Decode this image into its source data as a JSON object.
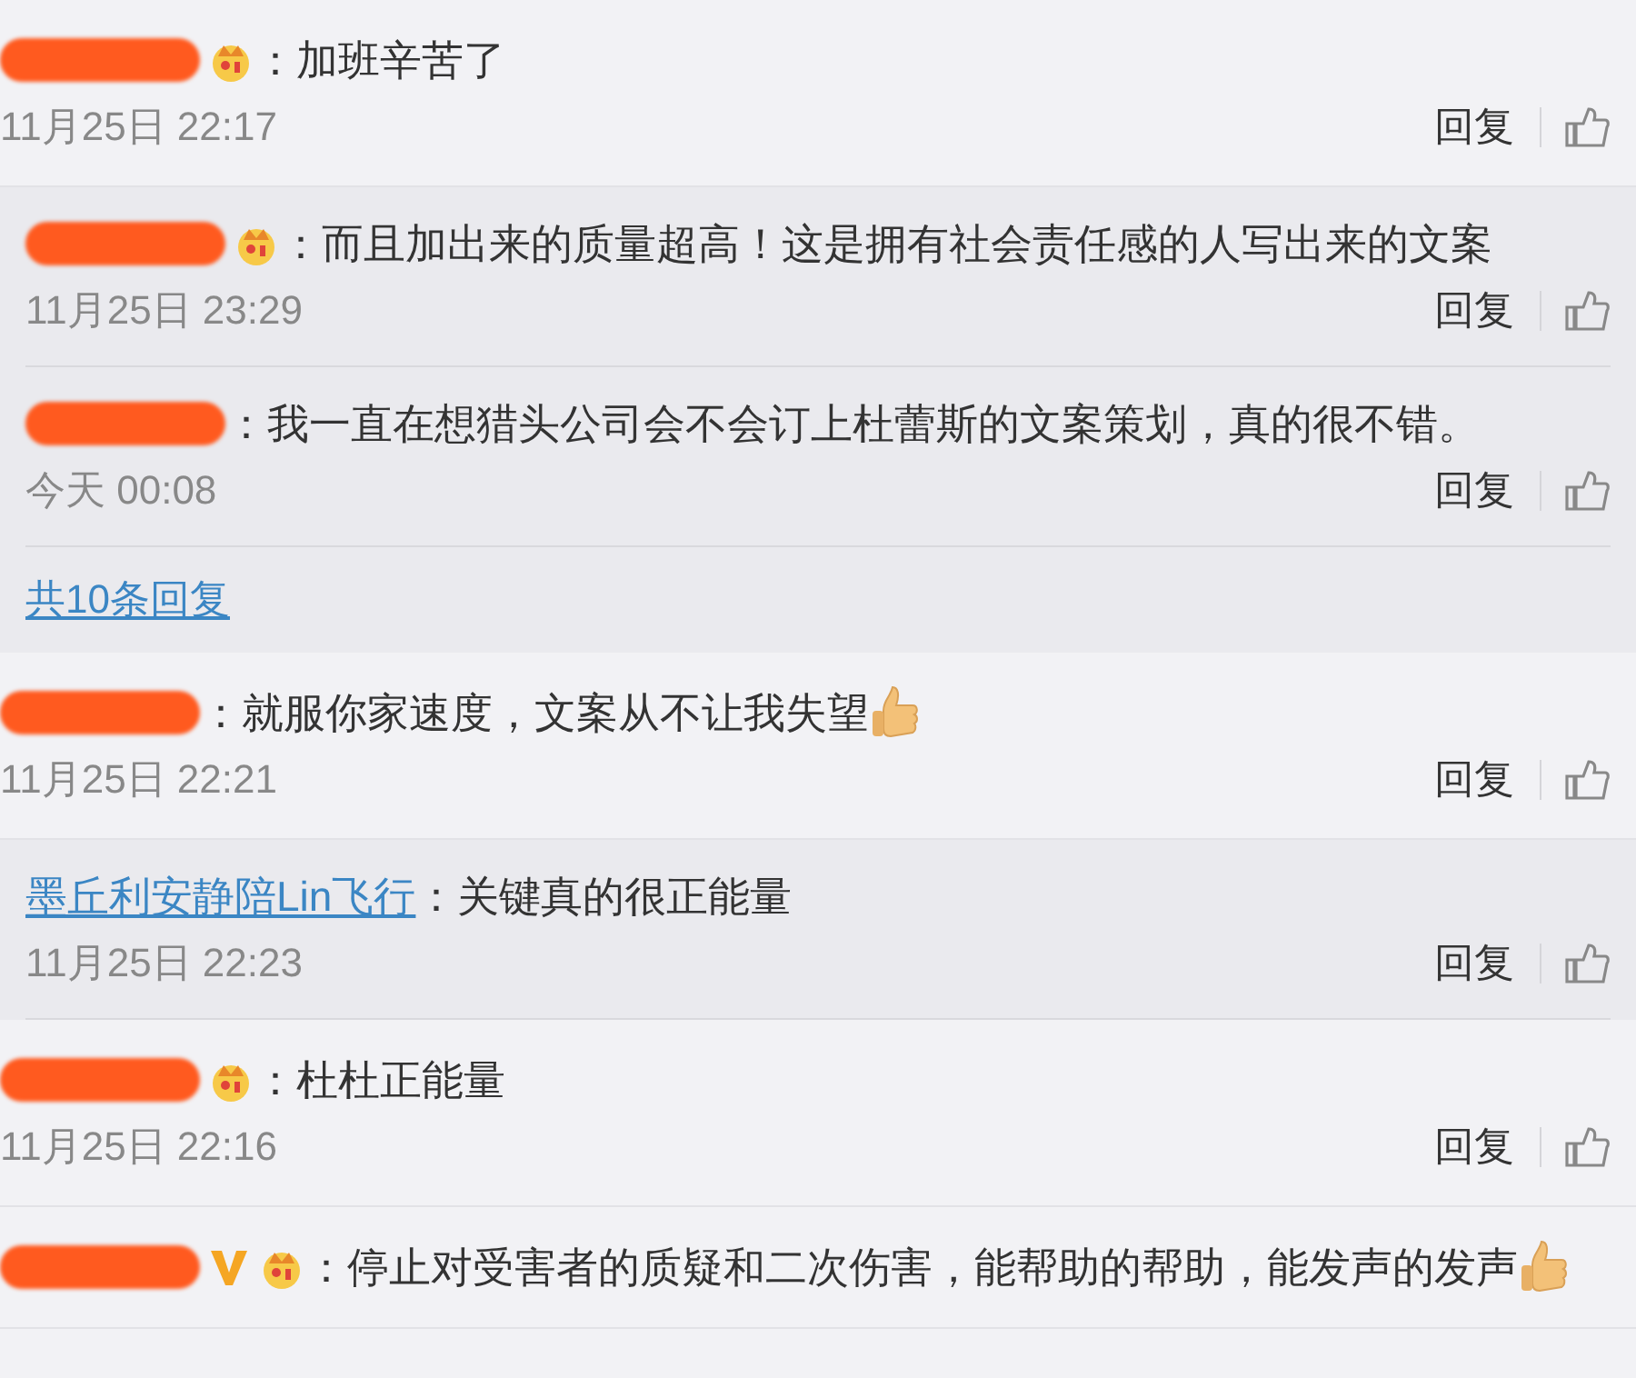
{
  "comments": [
    {
      "name": {
        "kind": "redacted"
      },
      "crown_badge": true,
      "text": "：加班辛苦了",
      "thumbs_emoji": false,
      "time": "11月25日 22:17",
      "reply_label": "回复",
      "replies": [
        {
          "name": {
            "kind": "redacted"
          },
          "crown_badge": true,
          "text": "：而且加出来的质量超高！这是拥有社会责任感的人写出来的文案",
          "time": "11月25日 23:29",
          "reply_label": "回复"
        },
        {
          "name": {
            "kind": "redacted"
          },
          "crown_badge": false,
          "text": "：我一直在想猎头公司会不会订上杜蕾斯的文案策划，真的很不错。",
          "time": "今天 00:08",
          "reply_label": "回复"
        }
      ],
      "more_replies": "共10条回复"
    },
    {
      "name": {
        "kind": "redacted"
      },
      "crown_badge": false,
      "text": "：就服你家速度，文案从不让我失望",
      "thumbs_emoji": true,
      "time": "11月25日 22:21",
      "reply_label": "回复",
      "replies": [
        {
          "name": {
            "kind": "link",
            "text": "墨丘利安静陪Lin飞行"
          },
          "crown_badge": false,
          "text": "：关键真的很正能量",
          "time": "11月25日 22:23",
          "reply_label": "回复"
        }
      ]
    },
    {
      "name": {
        "kind": "redacted"
      },
      "crown_badge": true,
      "text": "：杜杜正能量",
      "thumbs_emoji": false,
      "time": "11月25日 22:16",
      "reply_label": "回复"
    },
    {
      "name": {
        "kind": "redacted"
      },
      "vip_badge": true,
      "crown_badge": true,
      "text": "：停止对受害者的质疑和二次伤害，能帮助的帮助，能发声的发声",
      "thumbs_emoji": true
    }
  ]
}
